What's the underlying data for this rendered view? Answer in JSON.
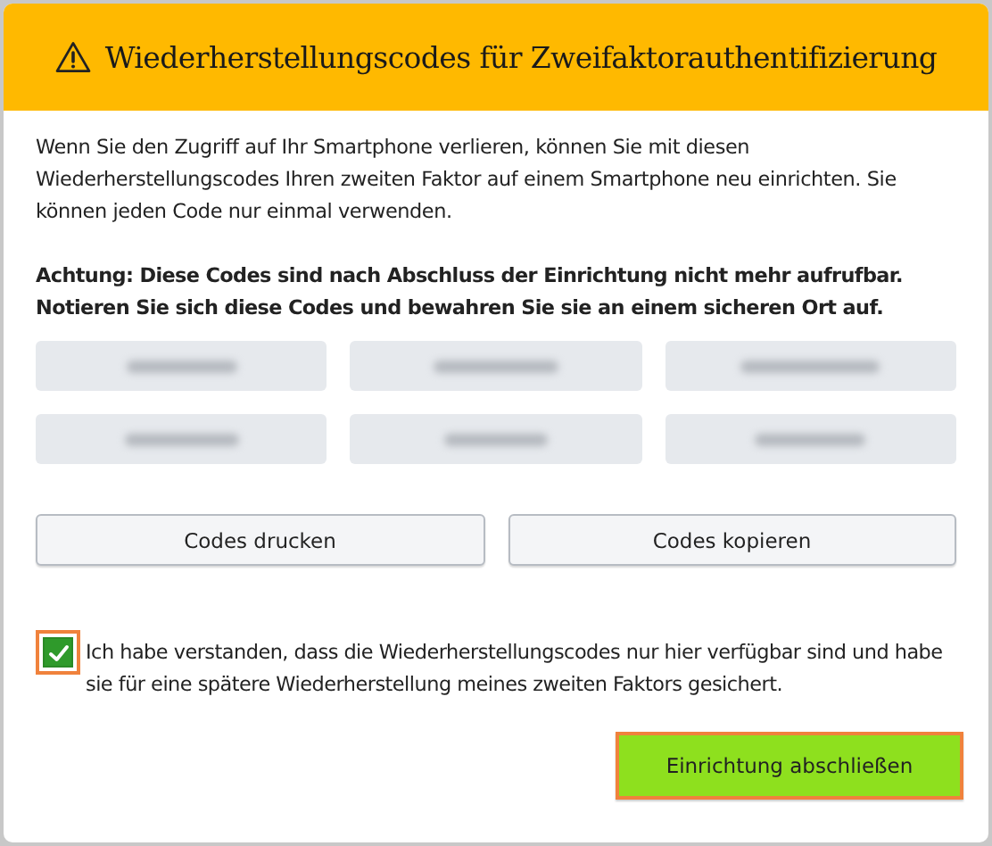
{
  "dialog": {
    "title": "Wiederherstellungscodes für Zweifaktorauthentifizierung",
    "intro": "Wenn Sie den Zugriff auf Ihr Smartphone verlieren, können Sie mit diesen Wiederherstellungscodes Ihren zweiten Faktor auf einem Smartphone neu einrichten. Sie können jeden Code nur einmal verwenden.",
    "warning": "Achtung: Diese Codes sind nach Abschluss der Einrichtung nicht mehr aufrufbar. Notieren Sie sich diese Codes und bewahren Sie sie an einem sicheren Ort auf.",
    "codes": [
      {
        "redacted": true
      },
      {
        "redacted": true
      },
      {
        "redacted": true
      },
      {
        "redacted": true
      },
      {
        "redacted": true
      },
      {
        "redacted": true
      }
    ],
    "actions": [
      {
        "label": "Codes drucken"
      },
      {
        "label": "Codes kopieren"
      }
    ],
    "confirmation": {
      "label": "Ich habe verstanden, dass die Wiederherstellungscodes nur hier verfügbar sind und habe sie für eine spätere Wiederherstellung meines zweiten Faktors gesichert.",
      "checked": true,
      "highlighted": true
    },
    "submit": {
      "label": "Einrichtung abschließen",
      "highlighted": true
    }
  }
}
